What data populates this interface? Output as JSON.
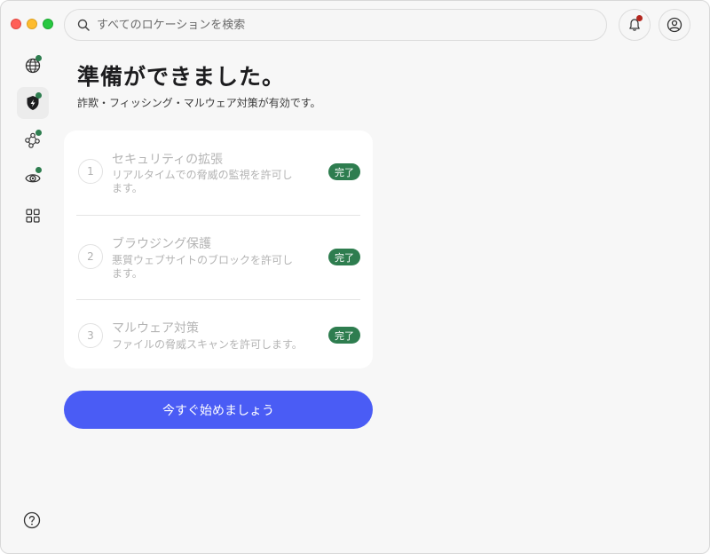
{
  "search": {
    "placeholder": "すべてのロケーションを検索"
  },
  "main": {
    "title": "準備ができました。",
    "subtitle": "詐欺・フィッシング・マルウェア対策が有効です。",
    "steps": [
      {
        "number": "1",
        "title": "セキュリティの拡張",
        "description": "リアルタイムでの脅威の監視を許可します。",
        "status": "完了"
      },
      {
        "number": "2",
        "title": "ブラウジング保護",
        "description": "悪質ウェブサイトのブロックを許可します。",
        "status": "完了"
      },
      {
        "number": "3",
        "title": "マルウェア対策",
        "description": "ファイルの脅威スキャンを許可します。",
        "status": "完了"
      }
    ],
    "cta_label": "今すぐ始めましょう"
  },
  "colors": {
    "accent": "#4a5cf5",
    "status_complete": "#2e7d4f",
    "notification_dot": "#b3261e"
  },
  "icons": {
    "sidebar": [
      "globe-icon",
      "shield-icon",
      "network-icon",
      "eye-icon",
      "grid-icon"
    ],
    "help": "question-icon"
  }
}
